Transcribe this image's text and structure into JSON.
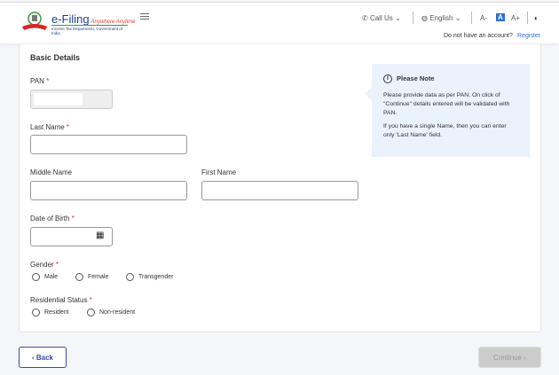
{
  "header": {
    "brand": "e-Filing",
    "tagline": "Anywhere Anytime",
    "subtitle": "Income Tax Department, Government of India",
    "call_us": "Call Us",
    "language": "English",
    "font_decrease": "A-",
    "font_normal": "A",
    "font_increase": "A+",
    "no_account": "Do not have an account?",
    "register": "Register"
  },
  "form": {
    "title": "Basic Details",
    "pan_label": "PAN",
    "last_name_label": "Last Name",
    "middle_name_label": "Middle Name",
    "first_name_label": "First Name",
    "dob_label": "Date of Birth",
    "gender_label": "Gender",
    "gender_options": [
      "Male",
      "Female",
      "Transgender"
    ],
    "residential_label": "Residential Status",
    "residential_options": [
      "Resident",
      "Non-resident"
    ],
    "required_mark": "*"
  },
  "note": {
    "title": "Please Note",
    "p1": "Please provide data as per PAN. On click of \"Continue\" details entered will be validated with PAN.",
    "p2": "If you have a single Name, then you can enter only 'Last Name' field."
  },
  "footer": {
    "back": "‹ Back",
    "continue": "Continue ›"
  },
  "colors": {
    "brand": "#1d3f8f",
    "accent": "#2f6fd1",
    "note_bg": "#eaf2fc"
  }
}
